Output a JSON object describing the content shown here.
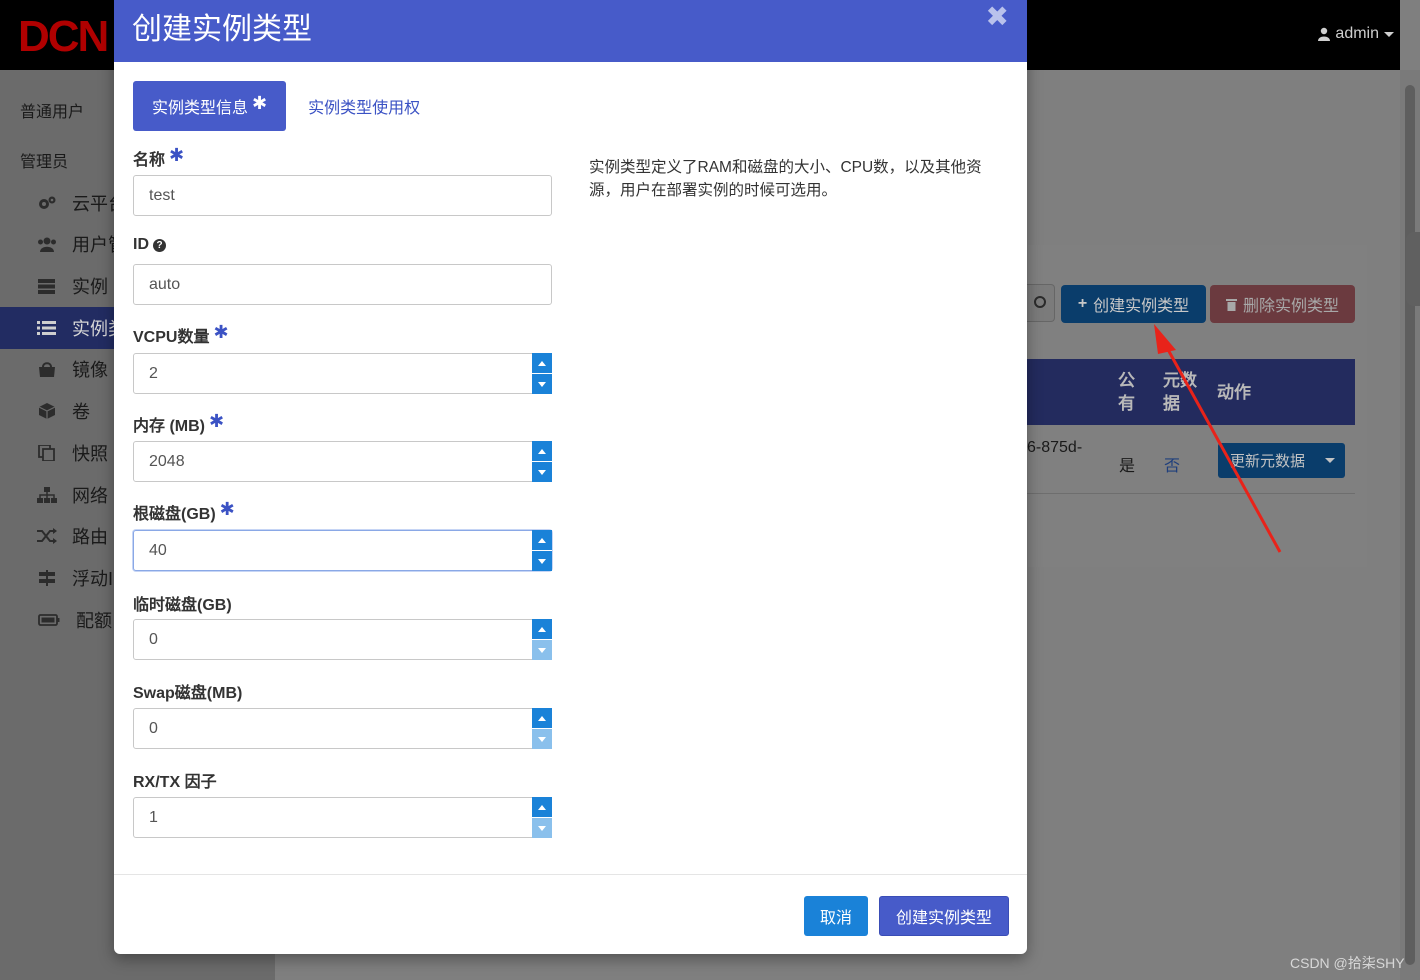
{
  "app": {
    "logo_text": "DCN",
    "user_name": "admin"
  },
  "sidebar": {
    "section_user": "普通用户",
    "section_admin": "管理员",
    "items": [
      {
        "label": "云平台",
        "icon": "gears-icon"
      },
      {
        "label": "用户管",
        "icon": "users-icon"
      },
      {
        "label": "实例",
        "icon": "server-icon"
      },
      {
        "label": "实例类",
        "icon": "list-icon",
        "active": true
      },
      {
        "label": "镜像",
        "icon": "image-icon"
      },
      {
        "label": "卷",
        "icon": "cube-icon"
      },
      {
        "label": "快照",
        "icon": "copy-icon"
      },
      {
        "label": "网络",
        "icon": "sitemap-icon"
      },
      {
        "label": "路由",
        "icon": "random-icon"
      },
      {
        "label": "浮动I",
        "icon": "signpost-icon"
      },
      {
        "label": "配额",
        "icon": "battery-icon"
      }
    ]
  },
  "background_page": {
    "create_button": "创建实例类型",
    "delete_button": "删除实例类型",
    "table_headers": {
      "public": "公\n有",
      "metadata": "元数\n据",
      "actions": "动作"
    },
    "row": {
      "id_fragment": "6-875d-",
      "public": "是",
      "metadata": "否",
      "action_button": "更新元数据"
    }
  },
  "modal": {
    "title": "创建实例类型",
    "tabs": [
      {
        "label": "实例类型信息",
        "required": "✱",
        "active": true
      },
      {
        "label": "实例类型使用权",
        "active": false
      }
    ],
    "description": "实例类型定义了RAM和磁盘的大小、CPU数，以及其他资源，用户在部署实例的时候可选用。",
    "fields": {
      "name": {
        "label": "名称",
        "required": "✱",
        "value": "test"
      },
      "id": {
        "label": "ID",
        "help": "?",
        "value": "auto"
      },
      "vcpu": {
        "label": "VCPU数量",
        "required": "✱",
        "value": "2"
      },
      "ram": {
        "label": "内存 (MB)",
        "required": "✱",
        "value": "2048"
      },
      "root_disk": {
        "label": "根磁盘(GB)",
        "required": "✱",
        "value": "40"
      },
      "ephemeral_disk": {
        "label": "临时磁盘(GB)",
        "value": "0"
      },
      "swap_disk": {
        "label": "Swap磁盘(MB)",
        "value": "0"
      },
      "rxtx_factor": {
        "label": "RX/TX 因子",
        "value": "1"
      }
    },
    "footer": {
      "cancel": "取消",
      "submit": "创建实例类型"
    }
  },
  "watermark": "CSDN @拾柒SHY",
  "colors": {
    "primary": "#475bc9",
    "info": "#1a82d8",
    "annotation_arrow": "#e8231a"
  }
}
